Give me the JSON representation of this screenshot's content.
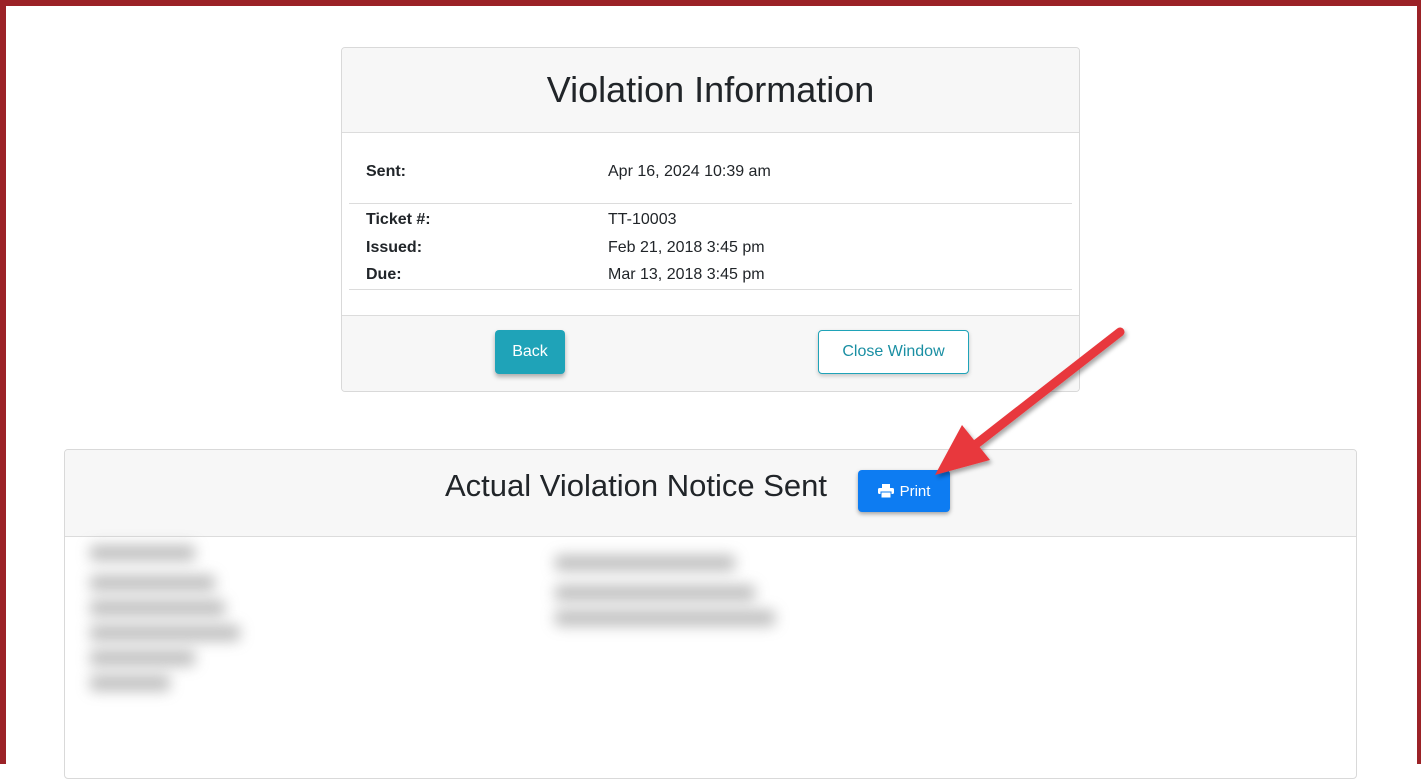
{
  "violation_info": {
    "title": "Violation Information",
    "sent": {
      "label": "Sent:",
      "value": "Apr 16, 2024 10:39 am"
    },
    "ticket": {
      "label": "Ticket #:",
      "value": "TT-10003"
    },
    "issued": {
      "label": "Issued:",
      "value": "Feb 21, 2018 3:45 pm"
    },
    "due": {
      "label": "Due:",
      "value": "Mar 13, 2018 3:45 pm"
    },
    "back_label": "Back",
    "close_label": "Close Window"
  },
  "notice": {
    "title": "Actual Violation Notice Sent",
    "print_label": "Print",
    "print_icon": "printer-icon"
  },
  "colors": {
    "frame_border": "#9b2227",
    "back_button": "#1fa3b8",
    "print_button": "#0d7cf2",
    "annotation_arrow": "#e8383d"
  }
}
